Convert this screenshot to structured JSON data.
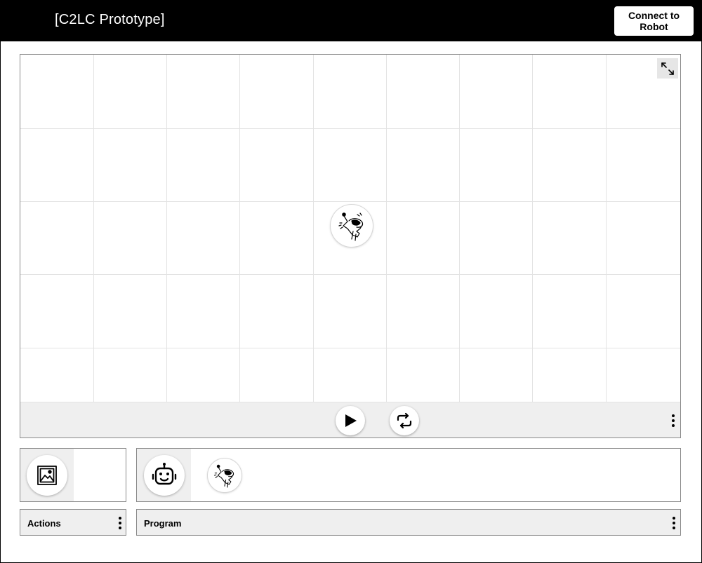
{
  "header": {
    "title": "[C2LC Prototype]",
    "connect_label": "Connect to Robot"
  },
  "scene": {
    "grid": {
      "columns": 9,
      "rows": 5
    },
    "character_icon": "dog-robot-character-icon",
    "fullscreen_icon": "expand-arrows-icon",
    "controls": {
      "play_icon": "play-icon",
      "refresh_icon": "refresh-icon",
      "menu_icon": "more-vertical-icon"
    }
  },
  "actions_panel": {
    "label": "Actions",
    "tab_icon": "image-icon"
  },
  "program_panel": {
    "label": "Program",
    "tab_icon": "robot-face-icon",
    "blocks": [
      "dog-robot-character-icon"
    ]
  },
  "colors": {
    "header_bg": "#000000",
    "panel_bg": "#efefef",
    "border": "#8a8a8a",
    "grid_line": "#e3e3e3"
  }
}
